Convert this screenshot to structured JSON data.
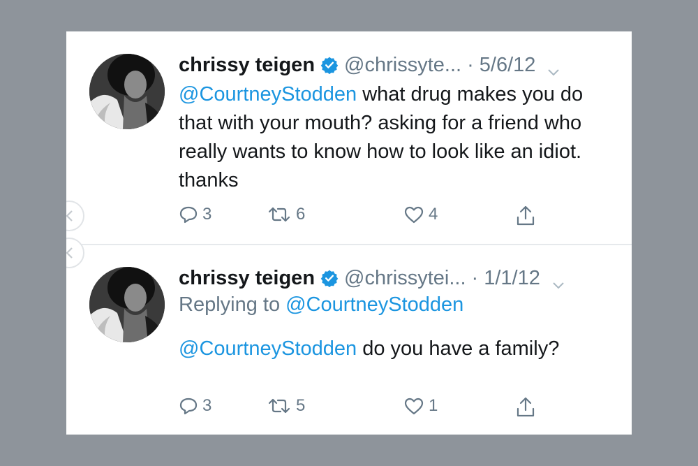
{
  "tweets": [
    {
      "name": "chrissy teigen",
      "handle": "@chrissyte...",
      "date": "· 5/6/12",
      "mention": "@CourtneyStodden",
      "text": " what drug makes you do that with your mouth? asking for a friend who really wants to know how to look like an idiot. thanks",
      "replies": "3",
      "retweets": "6",
      "likes": "4"
    },
    {
      "name": "chrissy teigen",
      "handle": "@chrissytei...",
      "date": "· 1/1/12",
      "replying_prefix": "Replying to ",
      "replying_to": "@CourtneyStodden",
      "mention": "@CourtneyStodden",
      "text": " do you have a family?",
      "replies": "3",
      "retweets": "5",
      "likes": "1"
    }
  ],
  "colors": {
    "background": "#8e949b",
    "card": "#ffffff",
    "link": "#1b95e0",
    "muted": "#657786",
    "text": "#14171a"
  },
  "icons": [
    "verified-badge-icon",
    "chevron-down-icon",
    "reply-icon",
    "retweet-icon",
    "like-icon",
    "share-icon",
    "prev-arrow-icon"
  ]
}
